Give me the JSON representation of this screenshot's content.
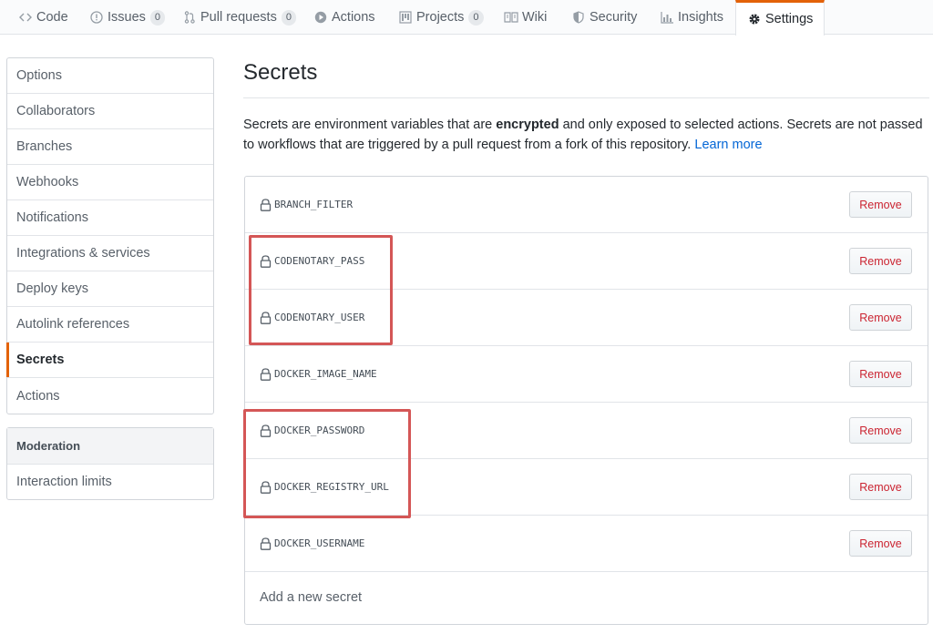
{
  "tabs": [
    {
      "label": "Code",
      "icon": "code-icon"
    },
    {
      "label": "Issues",
      "icon": "issue-icon",
      "count": "0"
    },
    {
      "label": "Pull requests",
      "icon": "pull-request-icon",
      "count": "0"
    },
    {
      "label": "Actions",
      "icon": "play-icon"
    },
    {
      "label": "Projects",
      "icon": "project-icon",
      "count": "0"
    },
    {
      "label": "Wiki",
      "icon": "book-icon"
    },
    {
      "label": "Security",
      "icon": "shield-icon"
    },
    {
      "label": "Insights",
      "icon": "graph-icon"
    },
    {
      "label": "Settings",
      "icon": "gear-icon",
      "selected": true
    }
  ],
  "menu": {
    "items": [
      "Options",
      "Collaborators",
      "Branches",
      "Webhooks",
      "Notifications",
      "Integrations & services",
      "Deploy keys",
      "Autolink references",
      "Secrets",
      "Actions"
    ],
    "selected": "Secrets"
  },
  "moderation": {
    "heading": "Moderation",
    "items": [
      "Interaction limits"
    ]
  },
  "main": {
    "title": "Secrets",
    "desc_part1": "Secrets are environment variables that are ",
    "desc_bold": "encrypted",
    "desc_part2": " and only exposed to selected actions. Secrets are not passed to workflows that are triggered by a pull request from a fork of this repository. ",
    "learn_more": "Learn more",
    "remove_label": "Remove",
    "add_secret": "Add a new secret",
    "secrets": [
      "BRANCH_FILTER",
      "CODENOTARY_PASS",
      "CODENOTARY_USER",
      "DOCKER_IMAGE_NAME",
      "DOCKER_PASSWORD",
      "DOCKER_REGISTRY_URL",
      "DOCKER_USERNAME"
    ]
  },
  "colors": {
    "accent": "#e36209",
    "highlight": "#d45656",
    "remove_text": "#cb2431",
    "link": "#0366d6"
  }
}
